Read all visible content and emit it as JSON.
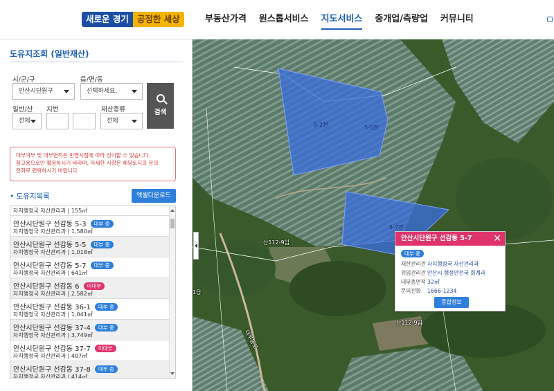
{
  "header": {
    "logo_part1": "새로운 경기",
    "logo_part2": "공정한 세상",
    "nav": [
      "부동산가격",
      "원스톱서비스",
      "지도서비스",
      "중개업/측량업",
      "커뮤니티"
    ],
    "active_nav": "지도서비스"
  },
  "panel": {
    "title": "도유지조회 (일반재산)",
    "labels": {
      "sigungu": "시/군/구",
      "eup": "읍/면/동",
      "general": "일반/산",
      "jibun": "지번",
      "asset_type": "재산종류"
    },
    "sigungu_value": "안산시단원구",
    "eup_value": "선택하세요.",
    "general_value": "전체",
    "asset_value": "전체",
    "search_label": "검색",
    "notice_line1": "대부여부 및 대부면적은 반영시점에 따라 상이할 수 있습니다.",
    "notice_line2": "참고용으로만 활용하시기 바라며, 자세한 사항은 해당토지의 문의",
    "notice_line3": "전화로 연락하시기 바랍니다.",
    "list_title": "• 도유지목록",
    "excel_label": "엑셀다운로드"
  },
  "list": {
    "partial_row": "자치행정국 자산관리과 | 155㎡",
    "rows": [
      {
        "name": "안산시단원구 선감동 5-3",
        "badge": "대부 중",
        "badge_color": "blue",
        "sub": "자치행정국 자산관리과 | 1,580㎡"
      },
      {
        "name": "안산시단원구 선감동 5-5",
        "badge": "대부 중",
        "badge_color": "blue",
        "sub": "자치행정국 자산관리과 | 1,018㎡"
      },
      {
        "name": "안산시단원구 선감동 5-7",
        "badge": "대부 중",
        "badge_color": "blue",
        "sub": "자치행정국 자산관리과 | 641㎡"
      },
      {
        "name": "안산시단원구 선감동 6",
        "badge": "미대부",
        "badge_color": "red",
        "sub": "자치행정국 자산관리과 | 2,582㎡"
      },
      {
        "name": "안산시단원구 선감동 36-1",
        "badge": "대부 중",
        "badge_color": "blue",
        "sub": "자치행정국 자산관리과 | 1,041㎡"
      },
      {
        "name": "안산시단원구 선감동 37-4",
        "badge": "대부 중",
        "badge_color": "blue",
        "sub": "자치행정국 자산관리과 | 3,749㎡"
      },
      {
        "name": "안산시단원구 선감동 37-7",
        "badge": "미대부",
        "badge_color": "red",
        "sub": "자치행정국 자산관리과 | 407㎡"
      },
      {
        "name": "안산시단원구 선감동 37-8",
        "badge": "대부 중",
        "badge_color": "blue",
        "sub": "자치행정국 자산관리과 | 414㎡"
      }
    ]
  },
  "popup": {
    "title": "안산시단원구 선감동 5-7",
    "close": "✕",
    "badge": "대부 중",
    "fields": [
      {
        "k": "재산관리관",
        "v": "자치행정국 자산관리과"
      },
      {
        "k": "위임관리관",
        "v": "안산시 행정안전국 회계과"
      },
      {
        "k": "대부총면적",
        "v": "32㎡"
      },
      {
        "k": "문의전화",
        "v": "1666-1234"
      }
    ],
    "detail_label": "종합정보"
  },
  "map_labels": {
    "parcel_a1": "5-2전",
    "parcel_a2": "5-5전",
    "parcel_b1": "5-7전",
    "parcel_b2": "5",
    "road1": "산112-9임",
    "road2": "산112-9임",
    "road3": "1답",
    "road4": "대부동로"
  },
  "colors": {
    "primary": "#1e5fb4",
    "popup_header": "#e0336b",
    "parcel_fill": "#3b6fe0"
  }
}
